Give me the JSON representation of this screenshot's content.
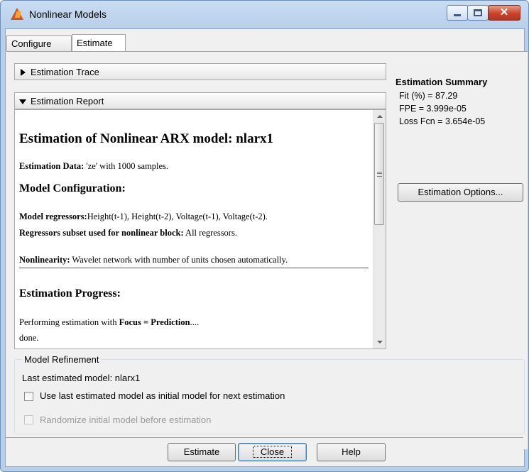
{
  "window": {
    "title": "Nonlinear Models",
    "icon": "matlab-logo-icon"
  },
  "tabs": [
    {
      "label": "Configure",
      "selected": false
    },
    {
      "label": "Estimate",
      "selected": true
    }
  ],
  "sections": {
    "trace_label": "Estimation Trace",
    "report_label": "Estimation Report"
  },
  "report": {
    "title": "Estimation of Nonlinear ARX model: nlarx1",
    "data_label": "Estimation Data:",
    "data_value": " 'ze' with 1000 samples.",
    "config_heading": "Model Configuration:",
    "regressors_label": "Model regressors:",
    "regressors_value": "Height(t-1), Height(t-2), Voltage(t-1), Voltage(t-2).",
    "subset_label": "Regressors subset used for nonlinear block:",
    "subset_value": " All regressors.",
    "nonlinearity_label": "Nonlinearity:",
    "nonlinearity_value": " Wavelet network with number of units chosen automatically.",
    "progress_heading": "Estimation Progress:",
    "performing_prefix": "Performing estimation with ",
    "focus_text": "Focus = Prediction",
    "performing_suffix": "....",
    "done_text": "done."
  },
  "summary": {
    "title": "Estimation Summary",
    "fit": "Fit (%) = 87.29",
    "fpe": "FPE = 3.999e-05",
    "loss": "Loss Fcn = 3.654e-05"
  },
  "buttons": {
    "estimation_options": "Estimation Options...",
    "estimate": "Estimate",
    "close": "Close",
    "help": "Help"
  },
  "refinement": {
    "legend": "Model Refinement",
    "last_model": "Last estimated model: nlarx1",
    "use_last_label": "Use last estimated model as initial model for next estimation",
    "randomize_label": "Randomize initial model before estimation"
  }
}
